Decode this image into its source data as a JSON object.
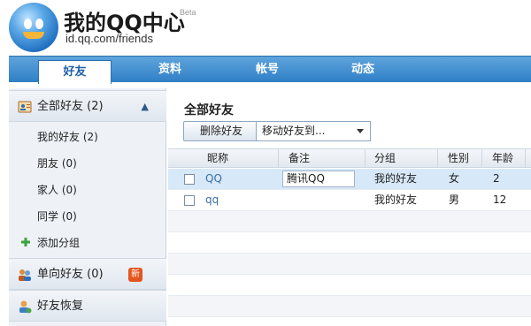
{
  "header": {
    "title": "我的QQ中心",
    "beta": "Beta",
    "url": "id.qq.com/friends"
  },
  "nav": {
    "tabs": [
      "好友",
      "资料",
      "帐号",
      "动态"
    ],
    "active_index": 0
  },
  "sidebar": {
    "all_friends": "全部好友 (2)",
    "groups": [
      "我的好友 (2)",
      "朋友 (0)",
      "家人 (0)",
      "同学 (0)"
    ],
    "add_group": "添加分组",
    "one_way": "单向好友 (0)",
    "new_badge": "新",
    "recover": "好友恢复"
  },
  "main": {
    "title": "全部好友",
    "delete_button": "删除好友",
    "move_select": "移动好友到..."
  },
  "table": {
    "headers": [
      "昵称",
      "备注",
      "分组",
      "性别",
      "年龄"
    ],
    "rows": [
      {
        "nick": "QQ",
        "remark": "腾讯QQ",
        "group": "我的好友",
        "gender": "女",
        "age": "2"
      },
      {
        "nick": "qq",
        "remark": "",
        "group": "我的好友",
        "gender": "男",
        "age": "12"
      }
    ]
  },
  "colors": {
    "nav_blue": "#2f7fc6",
    "selected_row": "#d7e8f8",
    "badge_orange": "#e4551e"
  }
}
